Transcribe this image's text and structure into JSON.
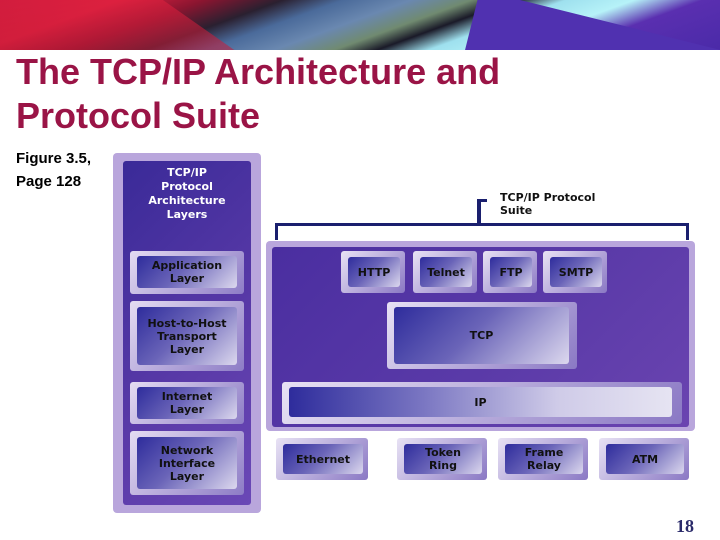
{
  "slide": {
    "title_line1": "The TCP/IP Architecture and",
    "title_line2": "Protocol Suite",
    "caption_line1": "Figure 3.5,",
    "caption_line2": "Page 128",
    "page_number": "18",
    "title_color": "#9a1446"
  },
  "diagram": {
    "architecture_heading": [
      "TCP/IP",
      "Protocol",
      "Architecture",
      "Layers"
    ],
    "layers": [
      {
        "lines": [
          "Application",
          "Layer"
        ]
      },
      {
        "lines": [
          "Host-to-Host",
          "Transport",
          "Layer"
        ]
      },
      {
        "lines": [
          "Internet",
          "Layer"
        ]
      },
      {
        "lines": [
          "Network",
          "Interface",
          "Layer"
        ]
      }
    ],
    "suite_label": [
      "TCP/IP Protocol",
      "Suite"
    ],
    "application_protocols": [
      "HTTP",
      "Telnet",
      "FTP",
      "SMTP"
    ],
    "transport_protocol": "TCP",
    "internet_protocol": "IP",
    "network_interfaces": [
      {
        "lines": [
          "Ethernet"
        ]
      },
      {
        "lines": [
          "Token",
          "Ring"
        ]
      },
      {
        "lines": [
          "Frame",
          "Relay"
        ]
      },
      {
        "lines": [
          "ATM"
        ]
      }
    ],
    "colors": {
      "panel_purple": "#5a3aa8",
      "panel_border": "#b9a6dc",
      "bracket": "#1a1f6e"
    }
  }
}
